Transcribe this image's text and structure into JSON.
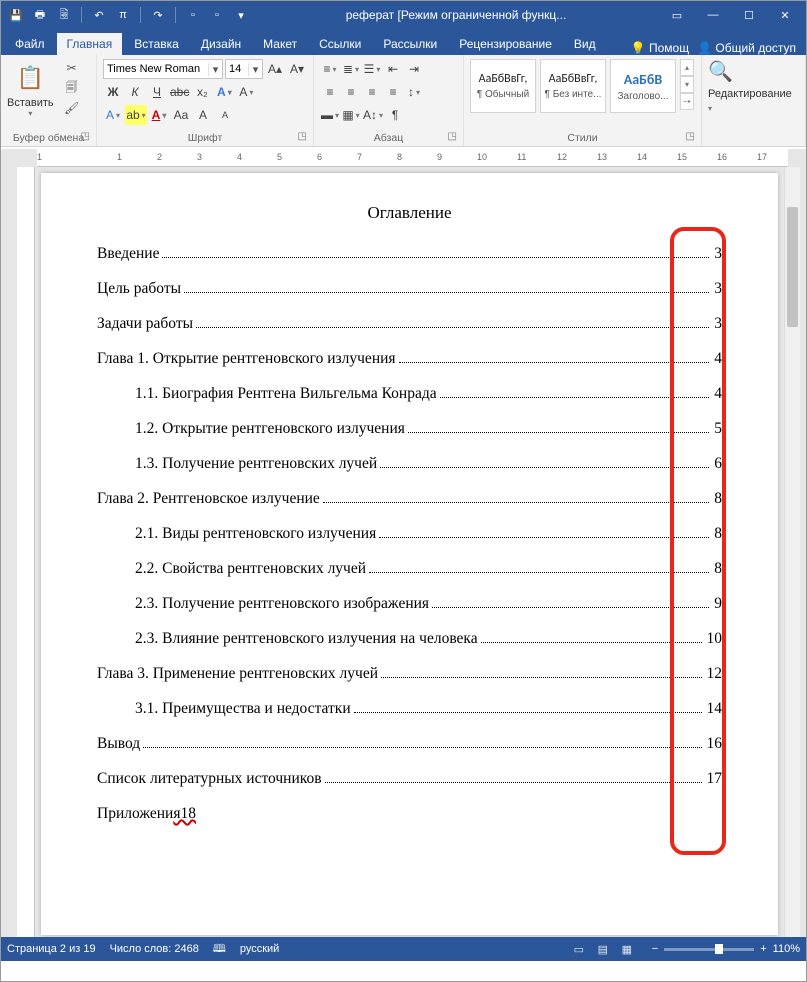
{
  "titlebar": {
    "doc_title": "реферат [Режим ограниченной функц..."
  },
  "tabs": {
    "file": "Файл",
    "home": "Главная",
    "insert": "Вставка",
    "design": "Дизайн",
    "layout": "Макет",
    "references": "Ссылки",
    "mailings": "Рассылки",
    "review": "Рецензирование",
    "view": "Вид",
    "tell_me": "Помощ",
    "share": "Общий доступ"
  },
  "ribbon": {
    "clipboard": {
      "label": "Буфер обмена",
      "paste": "Вставить"
    },
    "font": {
      "label": "Шрифт",
      "name": "Times New Roman",
      "size": "14"
    },
    "paragraph": {
      "label": "Абзац"
    },
    "styles": {
      "label": "Стили",
      "s1_sample": "АаБбВвГг,",
      "s1_name": "¶ Обычный",
      "s2_sample": "АаБбВвГг,",
      "s2_name": "¶ Без инте...",
      "s3_sample": "АаБбВ",
      "s3_name": "Заголово..."
    },
    "editing": {
      "label": "Редактирование"
    }
  },
  "ruler_numbers": [
    "1",
    "",
    "1",
    "2",
    "3",
    "4",
    "5",
    "6",
    "7",
    "8",
    "9",
    "10",
    "11",
    "12",
    "13",
    "14",
    "15",
    "16",
    "17"
  ],
  "toc": {
    "title": "Оглавление",
    "entries": [
      {
        "text": "Введение",
        "page": "3",
        "sub": false
      },
      {
        "text": "Цель работы",
        "page": "3",
        "sub": false
      },
      {
        "text": "Задачи работы",
        "page": "3",
        "sub": false
      },
      {
        "text": "Глава 1. Открытие рентгеновского излучения",
        "page": "4",
        "sub": false
      },
      {
        "text": "1.1. Биография Рентгена Вильгельма Конрада",
        "page": "4",
        "sub": true
      },
      {
        "text": "1.2. Открытие рентгеновского излучения",
        "page": "5",
        "sub": true
      },
      {
        "text": "1.3. Получение рентгеновских лучей",
        "page": "6",
        "sub": true
      },
      {
        "text": "Глава 2. Рентгеновское излучение",
        "page": "8",
        "sub": false
      },
      {
        "text": "2.1. Виды рентгеновского излучения",
        "page": "8",
        "sub": true
      },
      {
        "text": "2.2. Свойства рентгеновских лучей",
        "page": "8",
        "sub": true
      },
      {
        "text": "2.3. Получение рентгеновского изображения",
        "page": "9",
        "sub": true
      },
      {
        "text": "2.3. Влияние рентгеновского излучения на человека",
        "page": "10",
        "sub": true
      },
      {
        "text": "Глава 3. Применение рентгеновских лучей",
        "page": "12",
        "sub": false
      },
      {
        "text": "3.1. Преимущества и недостатки",
        "page": "14",
        "sub": true
      },
      {
        "text": "Вывод",
        "page": "16",
        "sub": false
      },
      {
        "text": "Список литературных источников",
        "page": "17",
        "sub": false
      }
    ],
    "last": {
      "prefix": "Приложени",
      "wavy": "я18"
    }
  },
  "status": {
    "page": "Страница 2 из 19",
    "words": "Число слов: 2468",
    "lang": "русский",
    "zoom": "110%"
  }
}
